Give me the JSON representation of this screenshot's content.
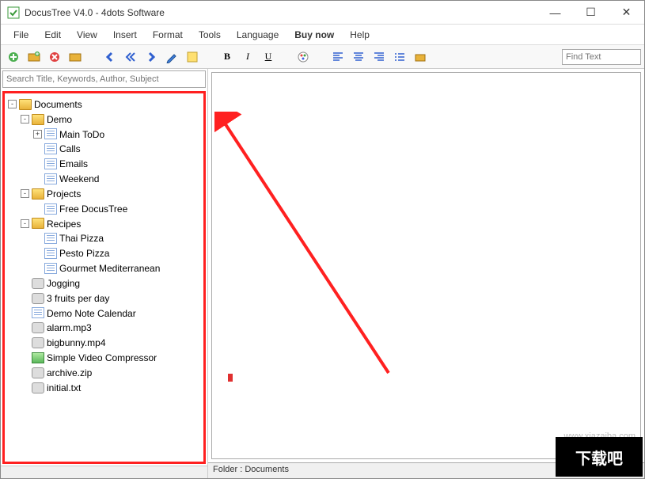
{
  "window": {
    "title": "DocusTree V4.0 - 4dots Software",
    "min": "—",
    "max": "☐",
    "close": "✕"
  },
  "menu": {
    "file": "File",
    "edit": "Edit",
    "view": "View",
    "insert": "Insert",
    "format": "Format",
    "tools": "Tools",
    "language": "Language",
    "buynow": "Buy now",
    "help": "Help"
  },
  "toolbar": {
    "bold": "B",
    "italic": "I",
    "underline": "U"
  },
  "search": {
    "placeholder": "Search Title, Keywords, Author, Subject",
    "find_placeholder": "Find Text"
  },
  "tree": {
    "root": "Documents",
    "demo": "Demo",
    "demo_children": {
      "main_todo": "Main ToDo",
      "calls": "Calls",
      "emails": "Emails",
      "weekend": "Weekend"
    },
    "projects": "Projects",
    "projects_children": {
      "free": "Free DocusTree"
    },
    "recipes": "Recipes",
    "recipes_children": {
      "thai": "Thai Pizza",
      "pesto": "Pesto Pizza",
      "gourmet": "Gourmet Mediterranean"
    },
    "jogging": "Jogging",
    "fruits": "3 fruits per day",
    "calendar": "Demo Note Calendar",
    "alarm": "alarm.mp3",
    "bigbunny": "bigbunny.mp4",
    "svc": "Simple Video Compressor",
    "archive": "archive.zip",
    "initial": "initial.txt"
  },
  "status": {
    "folder": "Folder : Documents"
  },
  "overlay": {
    "watermark": "www.xiazaiba.com",
    "logo": "下载吧"
  }
}
